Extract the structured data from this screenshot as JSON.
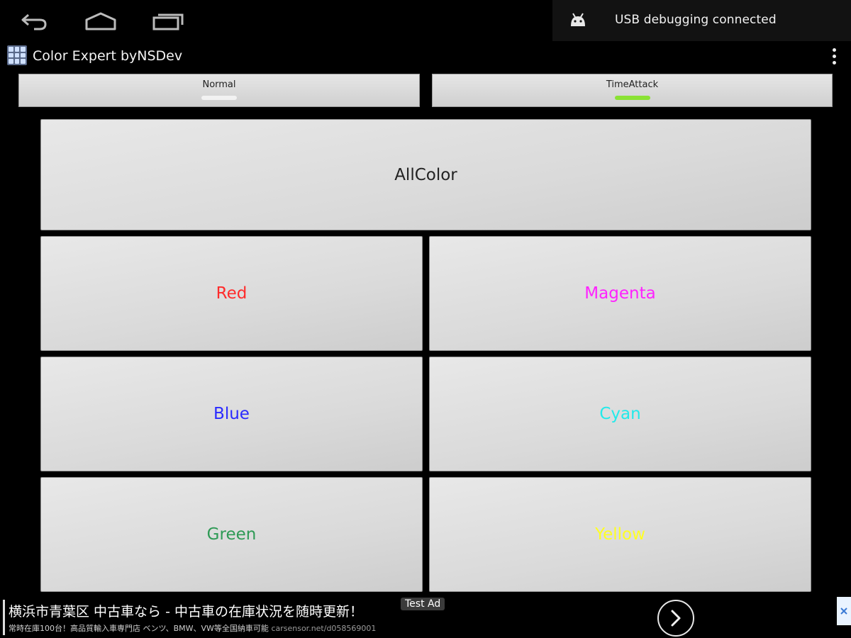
{
  "notification": {
    "text": "USB debugging connected",
    "icon": "android-icon"
  },
  "app": {
    "title": "Color Expert byNSDev",
    "icon": "grid-icon"
  },
  "tabs": [
    {
      "label": "Normal",
      "indicator_color": "#f2f2f2"
    },
    {
      "label": "TimeAttack",
      "indicator_color": "#8ae234"
    }
  ],
  "buttons": {
    "allcolor": {
      "label": "AllColor",
      "color": "#222222"
    },
    "red": {
      "label": "Red",
      "color": "#ff2b2b"
    },
    "magenta": {
      "label": "Magenta",
      "color": "#ff22ff"
    },
    "blue": {
      "label": "Blue",
      "color": "#2a2aff"
    },
    "cyan": {
      "label": "Cyan",
      "color": "#22eaea"
    },
    "green": {
      "label": "Green",
      "color": "#2e9a55"
    },
    "yellow": {
      "label": "Yellow",
      "color": "#ffff22"
    }
  },
  "ad": {
    "headline": "横浜市青葉区 中古車なら - 中古車の在庫状況を随時更新！",
    "subline": "常時在庫100台！高品質輸入車専門店 ベンツ、BMW、VW等全国納車可能",
    "url": "carsensor.net/d058569001",
    "badge": "Test Ad"
  }
}
